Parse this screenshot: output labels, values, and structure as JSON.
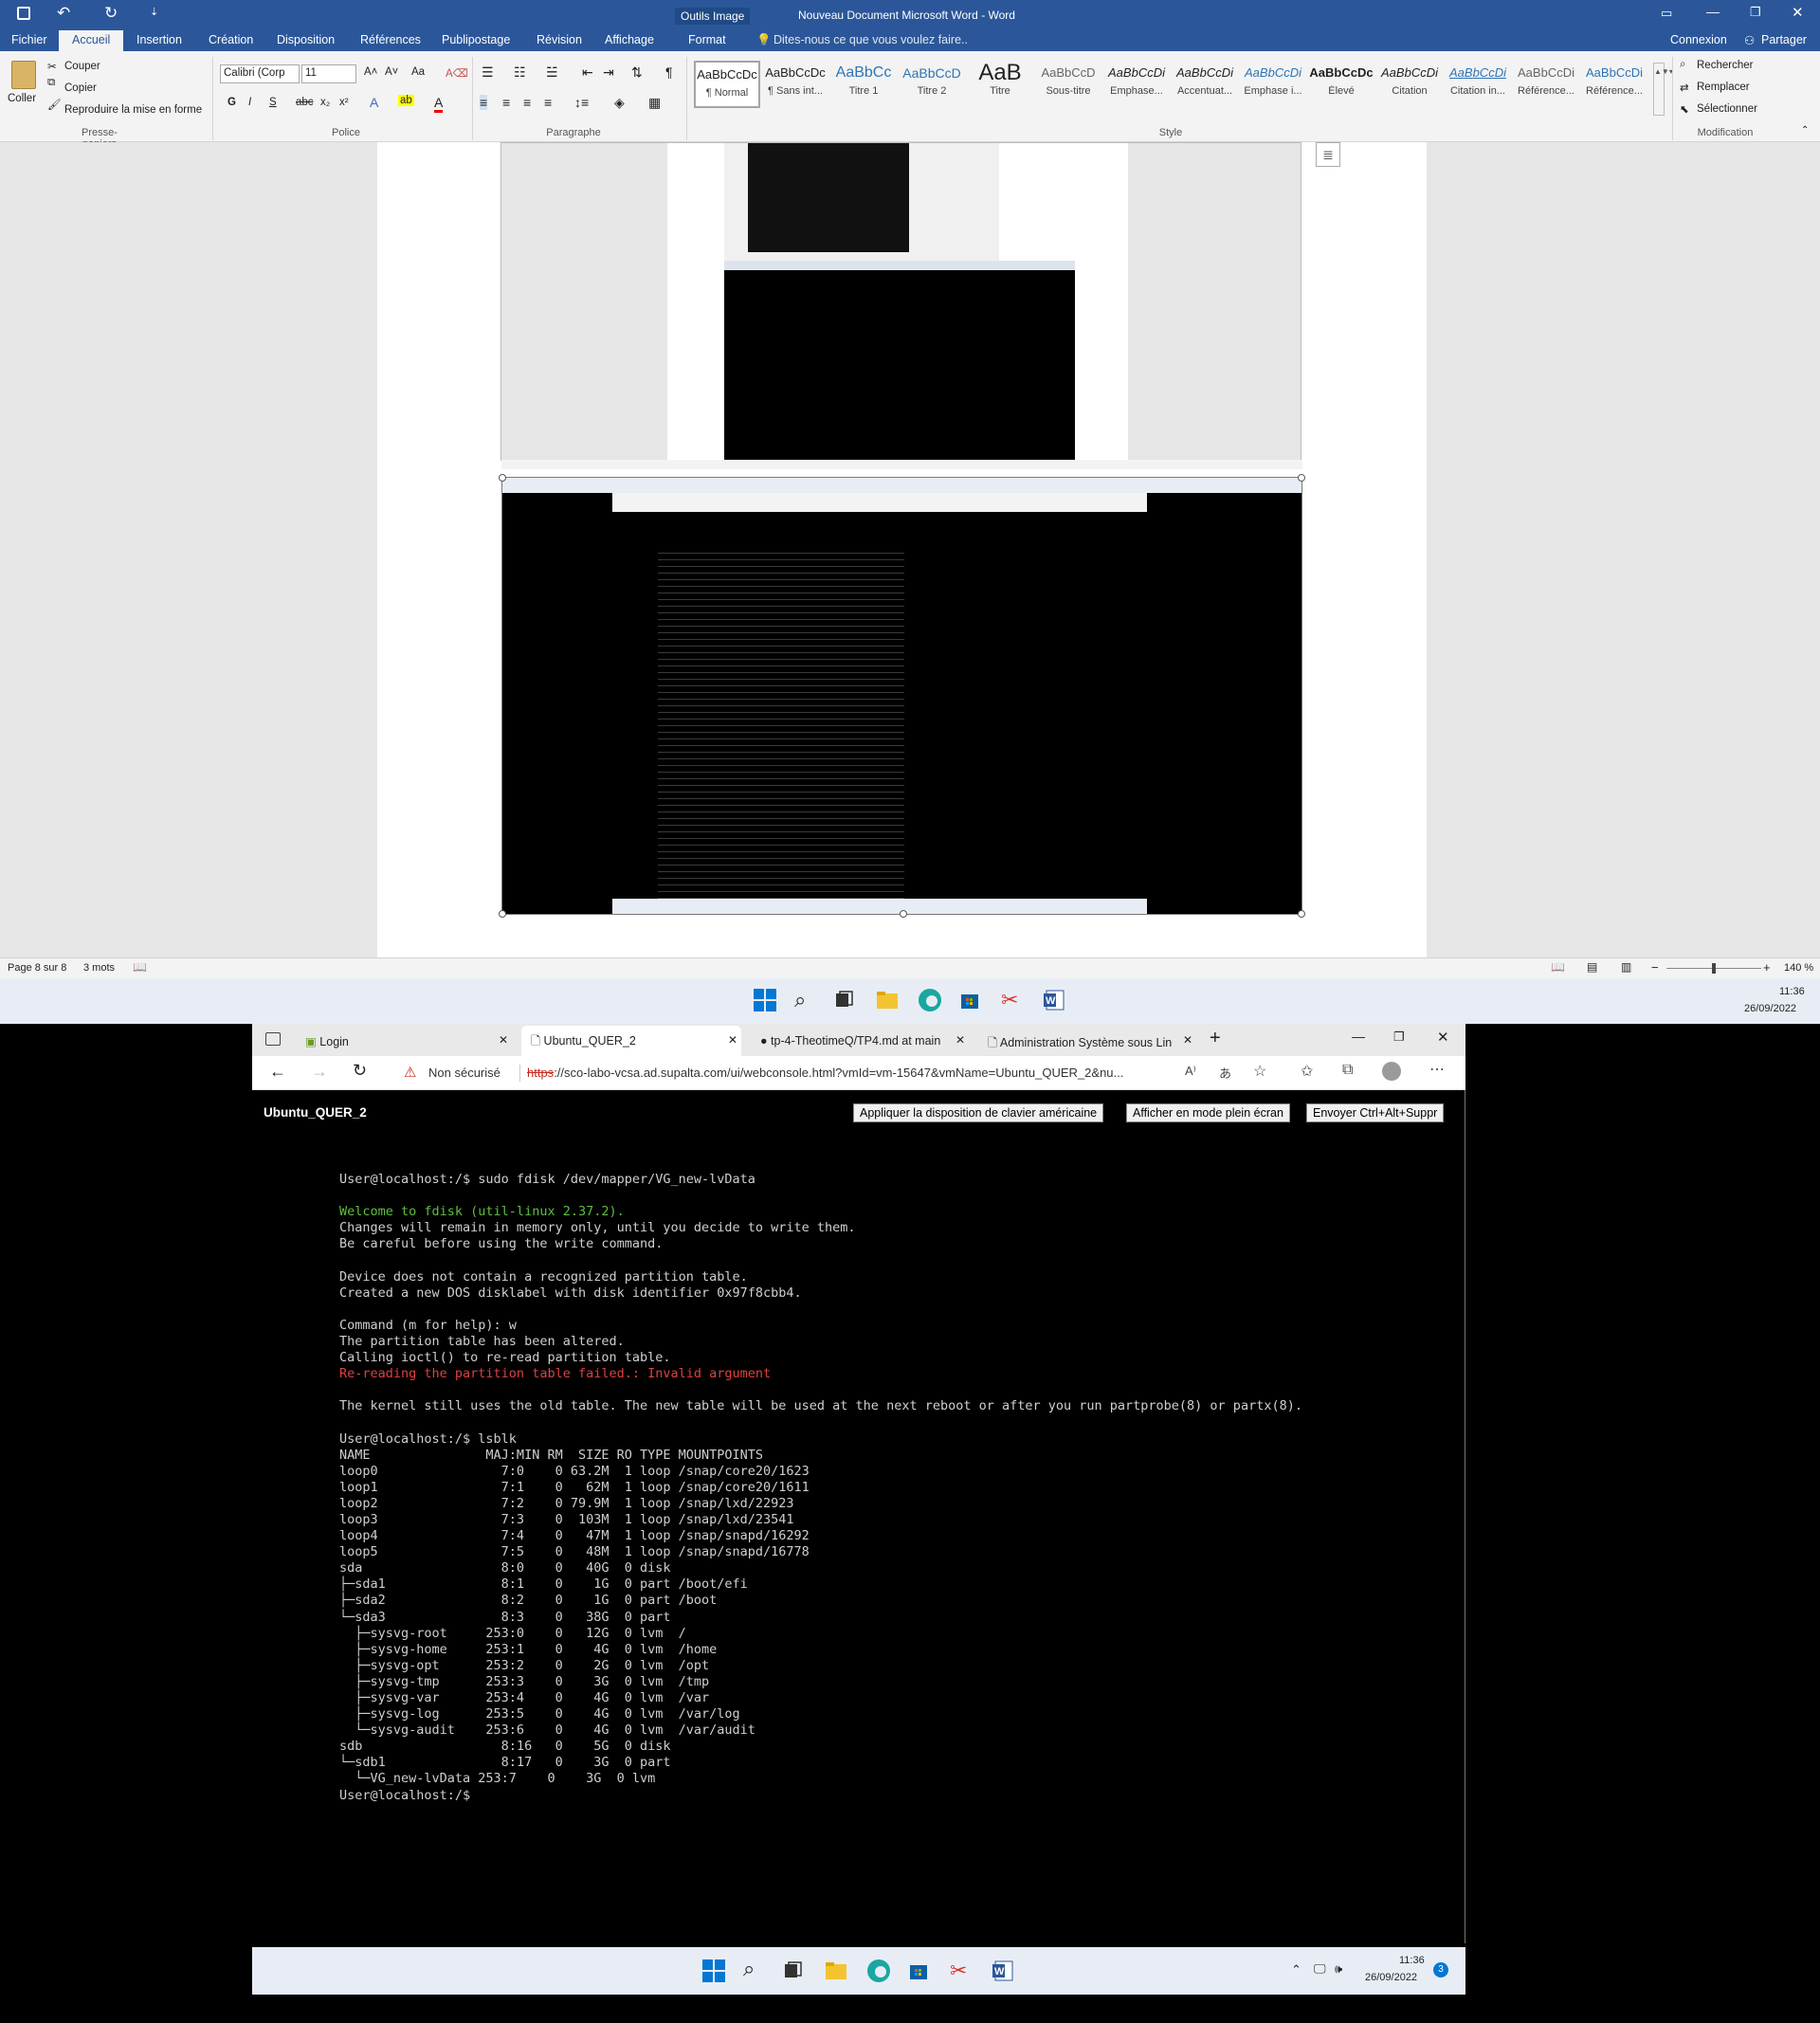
{
  "word": {
    "title": "Nouveau Document Microsoft Word - Word",
    "context_tab": "Outils Image",
    "tabs": [
      "Fichier",
      "Accueil",
      "Insertion",
      "Création",
      "Disposition",
      "Références",
      "Publipostage",
      "Révision",
      "Affichage",
      "Format"
    ],
    "tell_me": "Dites-nous ce que vous voulez faire..",
    "account": "Connexion",
    "share": "Partager",
    "clipboard": {
      "paste": "Coller",
      "cut": "Couper",
      "copy": "Copier",
      "format_painter": "Reproduire la mise en forme",
      "group": "Presse-papiers"
    },
    "font": {
      "name": "Calibri (Corp",
      "size": "11",
      "group": "Police",
      "bold": "G",
      "italic": "I",
      "underline": "S",
      "strike": "abc",
      "sub": "x₂",
      "sup": "x²",
      "case": "Aa"
    },
    "paragraph": {
      "group": "Paragraphe"
    },
    "styles": {
      "group": "Style",
      "items": [
        {
          "preview": "AaBbCcDc",
          "name": "¶ Normal"
        },
        {
          "preview": "AaBbCcDc",
          "name": "¶ Sans int..."
        },
        {
          "preview": "AaBbCc",
          "name": "Titre 1"
        },
        {
          "preview": "AaBbCcD",
          "name": "Titre 2"
        },
        {
          "preview": "AaB",
          "name": "Titre"
        },
        {
          "preview": "AaBbCcD",
          "name": "Sous-titre"
        },
        {
          "preview": "AaBbCcDi",
          "name": "Emphase..."
        },
        {
          "preview": "AaBbCcDi",
          "name": "Accentuat..."
        },
        {
          "preview": "AaBbCcDi",
          "name": "Emphase i..."
        },
        {
          "preview": "AaBbCcDc",
          "name": "Élevé"
        },
        {
          "preview": "AaBbCcDi",
          "name": "Citation"
        },
        {
          "preview": "AaBbCcDi",
          "name": "Citation in..."
        },
        {
          "preview": "AaBbCcDi",
          "name": "Référence..."
        },
        {
          "preview": "AaBbCcDi",
          "name": "Référence..."
        }
      ]
    },
    "editing": {
      "find": "Rechercher",
      "replace": "Remplacer",
      "select": "Sélectionner",
      "group": "Modification"
    },
    "status": {
      "page": "Page 8 sur 8",
      "words": "3 mots",
      "zoom": "140 %"
    }
  },
  "taskbar": {
    "time": "11:36",
    "date": "26/09/2022"
  },
  "browser": {
    "tabs": [
      "Login",
      "Ubuntu_QUER_2",
      "tp-4-TheotimeQ/TP4.md at main",
      "Administration Système sous Lin"
    ],
    "security": "Non sécurisé",
    "url_scheme": "https",
    "url_rest": "://sco-labo-vcsa.ad.supalta.com/ui/webconsole.html?vmId=vm-15647&vmName=Ubuntu_QUER_2&nu..."
  },
  "console": {
    "vm_name": "Ubuntu_QUER_2",
    "btn_keyboard": "Appliquer la disposition de clavier américaine",
    "btn_fullscreen": "Afficher en mode plein écran",
    "btn_cad": "Envoyer Ctrl+Alt+Suppr",
    "lines": [
      {
        "t": "User@localhost:/$ sudo fdisk /dev/mapper/VG_new-lvData",
        "c": ""
      },
      {
        "t": "",
        "c": ""
      },
      {
        "t": "Welcome to fdisk (util-linux 2.37.2).",
        "c": "g"
      },
      {
        "t": "Changes will remain in memory only, until you decide to write them.",
        "c": ""
      },
      {
        "t": "Be careful before using the write command.",
        "c": ""
      },
      {
        "t": "",
        "c": ""
      },
      {
        "t": "Device does not contain a recognized partition table.",
        "c": ""
      },
      {
        "t": "Created a new DOS disklabel with disk identifier 0x97f8cbb4.",
        "c": ""
      },
      {
        "t": "",
        "c": ""
      },
      {
        "t": "Command (m for help): w",
        "c": ""
      },
      {
        "t": "The partition table has been altered.",
        "c": ""
      },
      {
        "t": "Calling ioctl() to re-read partition table.",
        "c": ""
      },
      {
        "t": "Re-reading the partition table failed.: Invalid argument",
        "c": "r"
      },
      {
        "t": "",
        "c": ""
      },
      {
        "t": "The kernel still uses the old table. The new table will be used at the next reboot or after you run partprobe(8) or partx(8).",
        "c": ""
      },
      {
        "t": "",
        "c": ""
      },
      {
        "t": "User@localhost:/$ lsblk",
        "c": ""
      },
      {
        "t": "NAME               MAJ:MIN RM  SIZE RO TYPE MOUNTPOINTS",
        "c": ""
      },
      {
        "t": "loop0                7:0    0 63.2M  1 loop /snap/core20/1623",
        "c": ""
      },
      {
        "t": "loop1                7:1    0   62M  1 loop /snap/core20/1611",
        "c": ""
      },
      {
        "t": "loop2                7:2    0 79.9M  1 loop /snap/lxd/22923",
        "c": ""
      },
      {
        "t": "loop3                7:3    0  103M  1 loop /snap/lxd/23541",
        "c": ""
      },
      {
        "t": "loop4                7:4    0   47M  1 loop /snap/snapd/16292",
        "c": ""
      },
      {
        "t": "loop5                7:5    0   48M  1 loop /snap/snapd/16778",
        "c": ""
      },
      {
        "t": "sda                  8:0    0   40G  0 disk",
        "c": ""
      },
      {
        "t": "├─sda1               8:1    0    1G  0 part /boot/efi",
        "c": ""
      },
      {
        "t": "├─sda2               8:2    0    1G  0 part /boot",
        "c": ""
      },
      {
        "t": "└─sda3               8:3    0   38G  0 part",
        "c": ""
      },
      {
        "t": "  ├─sysvg-root     253:0    0   12G  0 lvm  /",
        "c": ""
      },
      {
        "t": "  ├─sysvg-home     253:1    0    4G  0 lvm  /home",
        "c": ""
      },
      {
        "t": "  ├─sysvg-opt      253:2    0    2G  0 lvm  /opt",
        "c": ""
      },
      {
        "t": "  ├─sysvg-tmp      253:3    0    3G  0 lvm  /tmp",
        "c": ""
      },
      {
        "t": "  ├─sysvg-var      253:4    0    4G  0 lvm  /var",
        "c": ""
      },
      {
        "t": "  ├─sysvg-log      253:5    0    4G  0 lvm  /var/log",
        "c": ""
      },
      {
        "t": "  └─sysvg-audit    253:6    0    4G  0 lvm  /var/audit",
        "c": ""
      },
      {
        "t": "sdb                  8:16   0    5G  0 disk",
        "c": ""
      },
      {
        "t": "└─sdb1               8:17   0    3G  0 part",
        "c": ""
      },
      {
        "t": "  └─VG_new-lvData 253:7    0    3G  0 lvm",
        "c": ""
      },
      {
        "t": "User@localhost:/$",
        "c": ""
      }
    ]
  },
  "vm_taskbar": {
    "time": "11:36",
    "date": "26/09/2022",
    "badge": "3"
  },
  "colors": {
    "word_blue": "#2b579a",
    "terminal_green": "#5fbf3f",
    "terminal_red": "#e04040",
    "windows_blue": "#0078d4"
  }
}
